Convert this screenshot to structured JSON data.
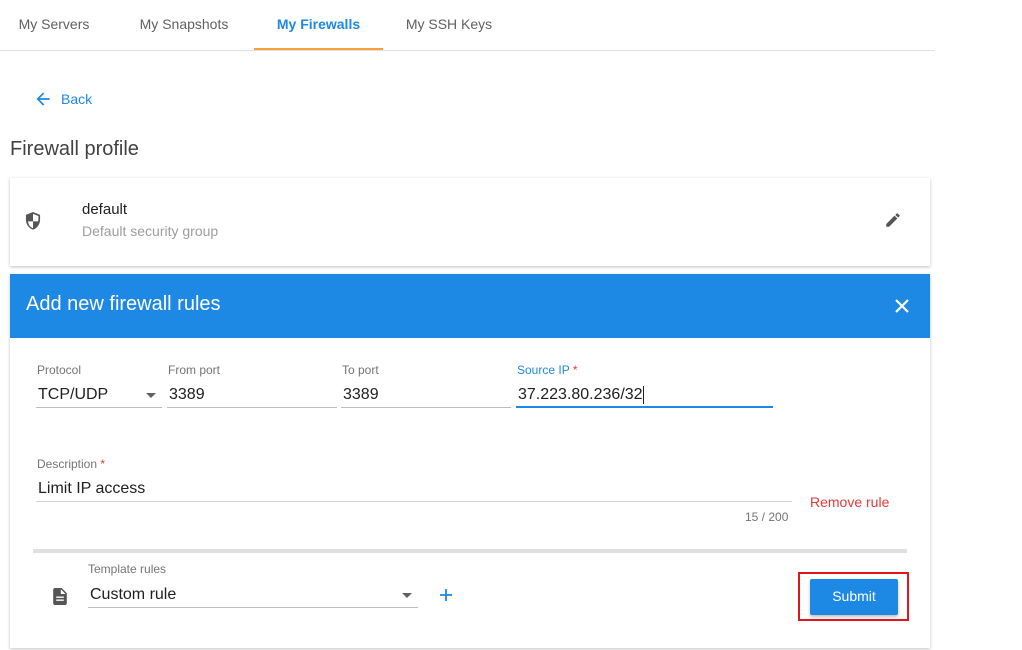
{
  "tabs": [
    {
      "label": "My Servers",
      "active": false
    },
    {
      "label": "My Snapshots",
      "active": false
    },
    {
      "label": "My Firewalls",
      "active": true
    },
    {
      "label": "My SSH Keys",
      "active": false
    }
  ],
  "back_label": "Back",
  "page_title": "Firewall profile",
  "profile": {
    "name": "default",
    "description": "Default security group",
    "icons": {
      "shield": "shield-icon",
      "edit": "pencil-icon"
    }
  },
  "dialog": {
    "title": "Add new firewall rules",
    "close_icon": "close-icon",
    "rule": {
      "protocol": {
        "label": "Protocol",
        "value": "TCP/UDP"
      },
      "from_port": {
        "label": "From port",
        "value": "3389"
      },
      "to_port": {
        "label": "To port",
        "value": "3389"
      },
      "source_ip": {
        "label": "Source IP",
        "required_mark": "*",
        "value": "37.223.80.236/32"
      },
      "description": {
        "label": "Description",
        "required_mark": "*",
        "value": "Limit IP access",
        "counter": "15 / 200"
      },
      "remove_label": "Remove rule"
    },
    "template": {
      "label": "Template rules",
      "value": "Custom rule",
      "icon": "document-icon",
      "add_icon": "plus-icon"
    },
    "submit_label": "Submit"
  },
  "colors": {
    "primary": "#1e88e5",
    "accent": "#f5a03b",
    "danger": "#e53935",
    "highlight": "#e0161b"
  }
}
